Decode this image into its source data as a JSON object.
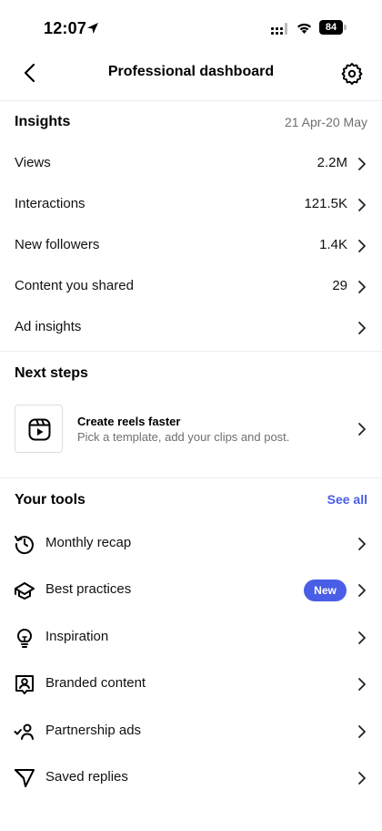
{
  "status_bar": {
    "time": "12:07",
    "battery": "84"
  },
  "header": {
    "title": "Professional dashboard"
  },
  "insights": {
    "title": "Insights",
    "date_range": "21 Apr-20 May",
    "rows": [
      {
        "label": "Views",
        "value": "2.2M"
      },
      {
        "label": "Interactions",
        "value": "121.5K"
      },
      {
        "label": "New followers",
        "value": "1.4K"
      },
      {
        "label": "Content you shared",
        "value": "29"
      },
      {
        "label": "Ad insights",
        "value": ""
      }
    ]
  },
  "next_steps": {
    "title": "Next steps",
    "card_title": "Create reels faster",
    "card_subtitle": "Pick a template, add your clips and post."
  },
  "tools": {
    "title": "Your tools",
    "see_all": "See all",
    "badge": "New",
    "items": [
      {
        "label": "Monthly recap",
        "icon": "history-icon"
      },
      {
        "label": "Best practices",
        "icon": "graduation-cap-icon"
      },
      {
        "label": "Inspiration",
        "icon": "lightbulb-icon"
      },
      {
        "label": "Branded content",
        "icon": "branded-content-icon"
      },
      {
        "label": "Partnership ads",
        "icon": "partnership-icon"
      },
      {
        "label": "Saved replies",
        "icon": "send-icon"
      }
    ]
  },
  "colors": {
    "accent": "#4a5de6",
    "muted": "#6f6f6f"
  }
}
